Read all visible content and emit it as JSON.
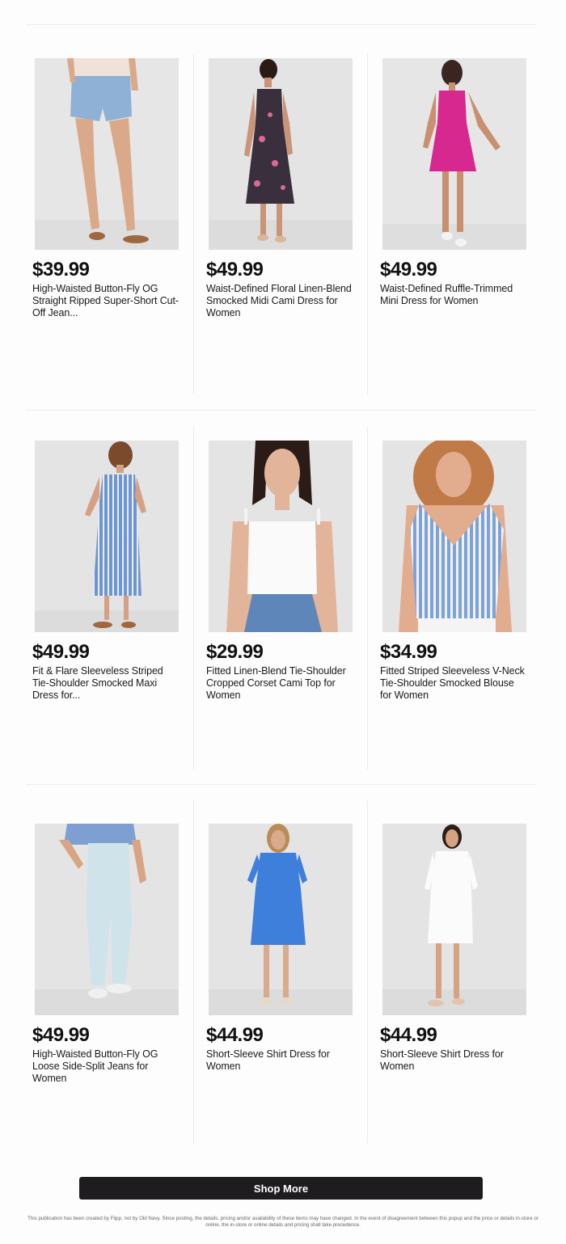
{
  "products": [
    {
      "price": "$39.99",
      "title": "High-Waisted Button-Fly OG Straight Ripped Super-Short Cut-Off Jean...",
      "image": "denim-shorts-photo",
      "colors": {
        "top": "#efe2d8",
        "bottom": "#8fb1d6",
        "skin": "#d9a98a",
        "shoe": "#a0673f"
      }
    },
    {
      "price": "$49.99",
      "title": "Waist-Defined Floral Linen-Blend Smocked Midi Cami Dress for Women",
      "image": "floral-midi-dress-photo",
      "colors": {
        "dress": "#3a2f3c",
        "accent": "#d76a9a",
        "skin": "#c99477",
        "shoe": "#d8b79a"
      }
    },
    {
      "price": "$49.99",
      "title": "Waist-Defined Ruffle-Trimmed Mini Dress for Women",
      "image": "pink-mini-dress-photo",
      "colors": {
        "dress": "#d6288f",
        "skin": "#c8906f",
        "shoe": "#f3f3f3"
      }
    },
    {
      "price": "$49.99",
      "title": "Fit & Flare Sleeveless Striped Tie-Shoulder Smocked Maxi Dress for...",
      "image": "striped-maxi-dress-photo",
      "colors": {
        "dress": "#6f95cf",
        "stripe": "#e8eef8",
        "skin": "#d6a183",
        "shoe": "#a0673f"
      }
    },
    {
      "price": "$29.99",
      "title": "Fitted Linen-Blend Tie-Shoulder Cropped Corset Cami Top for Women",
      "image": "white-cami-top-photo",
      "colors": {
        "top": "#fafafa",
        "bottom": "#5f86b8",
        "skin": "#e2b499",
        "hair": "#2a1b16"
      }
    },
    {
      "price": "$34.99",
      "title": "Fitted Striped Sleeveless V-Neck Tie-Shoulder Smocked Blouse for Women",
      "image": "striped-blouse-photo",
      "colors": {
        "top": "#7ea2d6",
        "stripe": "#eef3fb",
        "skin": "#e2ad8f",
        "hair": "#c07a48"
      }
    },
    {
      "price": "$49.99",
      "title": "High-Waisted Button-Fly OG Loose Side-Split Jeans for Women",
      "image": "light-wash-jeans-photo",
      "colors": {
        "top": "#7e9fd2",
        "bottom": "#cfe3ea",
        "skin": "#d7a584",
        "shoe": "#f0f0f0"
      }
    },
    {
      "price": "$44.99",
      "title": "Short-Sleeve Shirt Dress for Women",
      "image": "blue-shirt-dress-photo",
      "colors": {
        "dress": "#3f7fdc",
        "skin": "#d9aa8b",
        "hair": "#b98c55",
        "shoe": "#e7d8c8"
      }
    },
    {
      "price": "$44.99",
      "title": "Short-Sleeve Shirt Dress for Women",
      "image": "white-shirt-dress-photo",
      "colors": {
        "dress": "#fbfbfb",
        "skin": "#d7a281",
        "hair": "#2b1d17",
        "shoe": "#e2c4ac"
      }
    }
  ],
  "shop_more_label": "Shop More",
  "disclaimer": "This publication has been created by Flipp, not by Old Navy. Since posting, the details, pricing and/or availability of these items may have changed. In the event of disagreement between this popup and the price or details in-store or online, the in-store or online details and pricing shall take precedence.",
  "colors": {
    "button_bg": "#1f1c1f",
    "divider": "#ececec",
    "image_bg": "#e4e4e4"
  }
}
